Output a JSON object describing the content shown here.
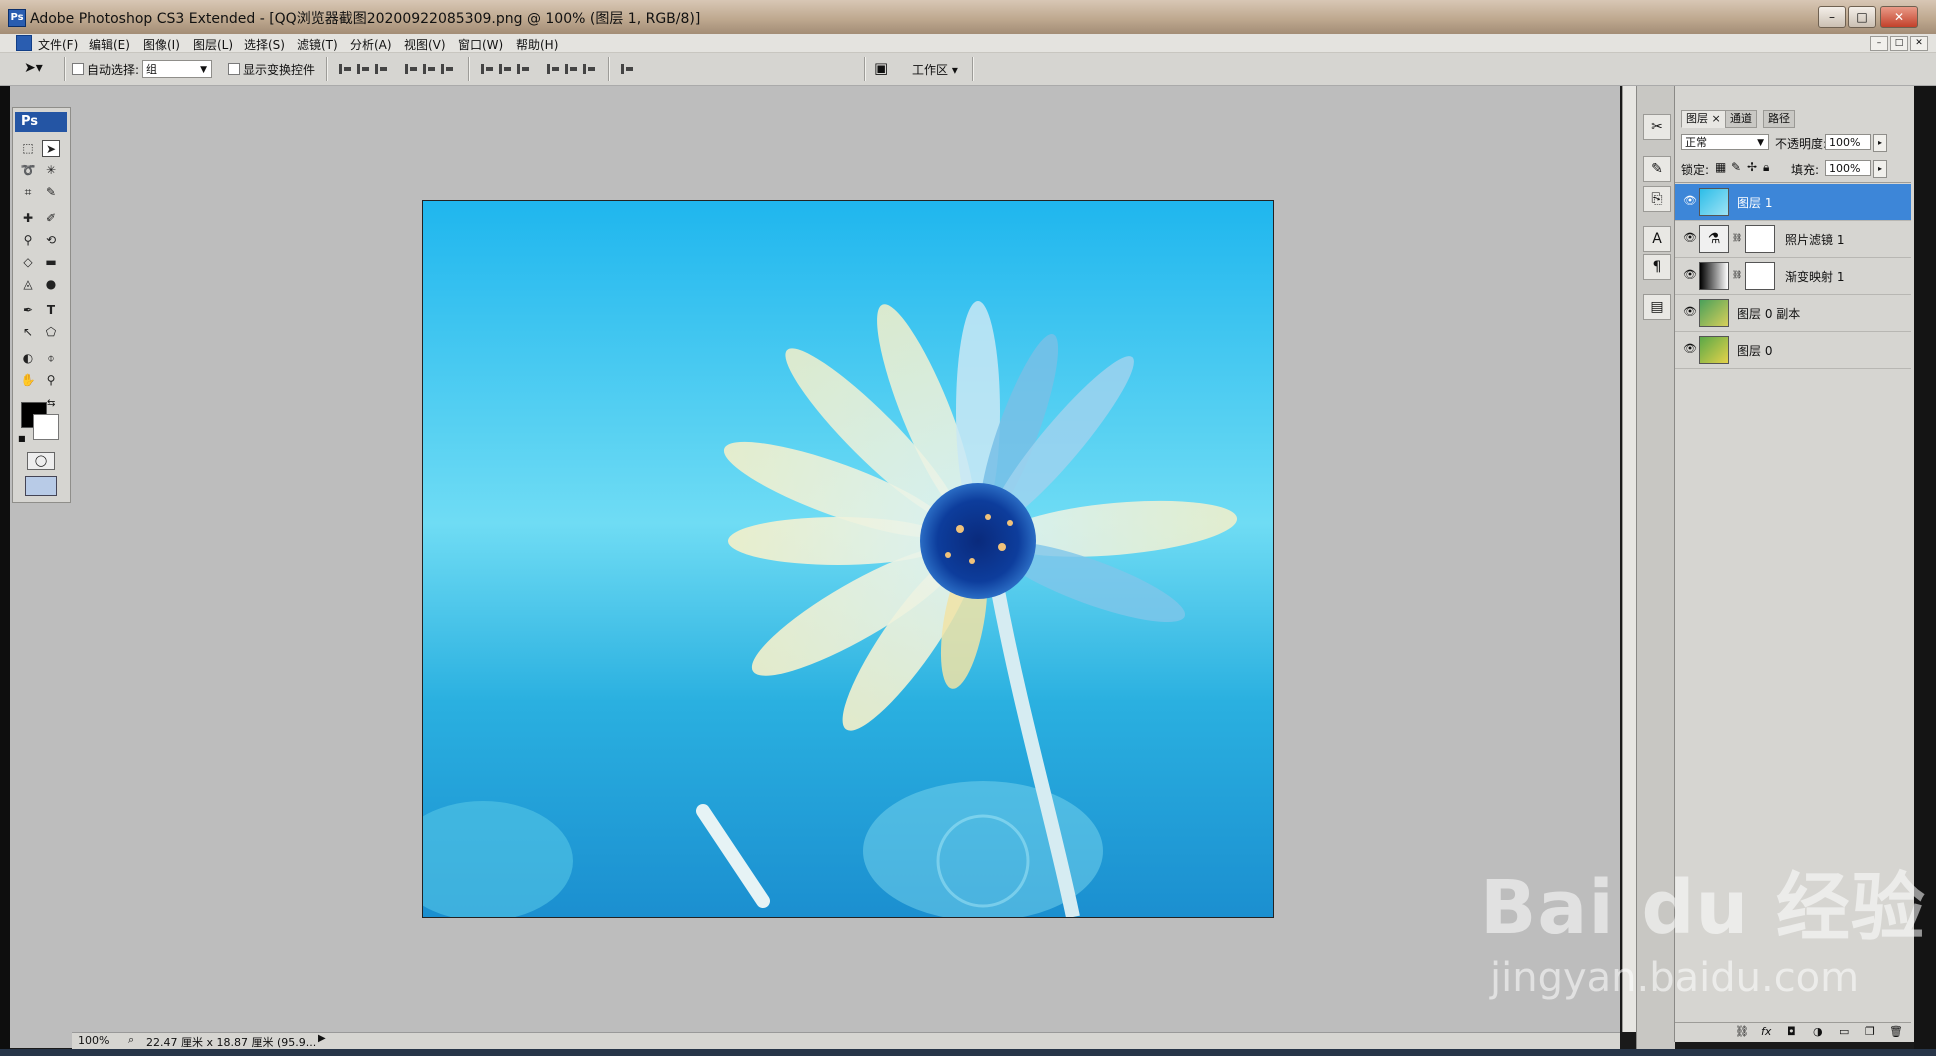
{
  "window": {
    "title": "Adobe Photoshop CS3 Extended - [QQ浏览器截图20200922085309.png @ 100% (图层 1, RGB/8)]",
    "controls": [
      "–",
      "□",
      "✕"
    ]
  },
  "menubar": {
    "items": [
      "文件(F)",
      "编辑(E)",
      "图像(I)",
      "图层(L)",
      "选择(S)",
      "滤镜(T)",
      "分析(A)",
      "视图(V)",
      "窗口(W)",
      "帮助(H)"
    ]
  },
  "options": {
    "auto_select_label": "自动选择:",
    "auto_select_value": "组",
    "show_transform_label": "显示变换控件",
    "workspace_label": "工作区 ▾"
  },
  "toolbox": {
    "header": "Ps"
  },
  "status": {
    "zoom": "100%",
    "doc_info": "22.47 厘米 x 18.87 厘米 (95.9..."
  },
  "layers_panel": {
    "tabs": [
      "图层",
      "通道",
      "路径"
    ],
    "blend_mode": "正常",
    "opacity_label": "不透明度:",
    "opacity_value": "100%",
    "lock_label": "锁定:",
    "fill_label": "填充:",
    "fill_value": "100%",
    "layers": [
      {
        "name": "图层 1",
        "selected": true
      },
      {
        "name": "照片滤镜 1",
        "selected": false
      },
      {
        "name": "渐变映射 1",
        "selected": false
      },
      {
        "name": "图层 0 副本",
        "selected": false
      },
      {
        "name": "图层 0",
        "selected": false
      }
    ],
    "bottom_icons": [
      "link-icon",
      "fx-icon",
      "mask-icon",
      "adjustment-icon",
      "folder-icon",
      "new-layer-icon",
      "trash-icon"
    ]
  },
  "watermark": {
    "brand": "Bai du 经验",
    "url": "jingyan.baidu.com"
  },
  "colors": {
    "selection": "#3d86d8",
    "canvas_sky": "#3cc3e8",
    "workspace": "#bdbdbd"
  }
}
